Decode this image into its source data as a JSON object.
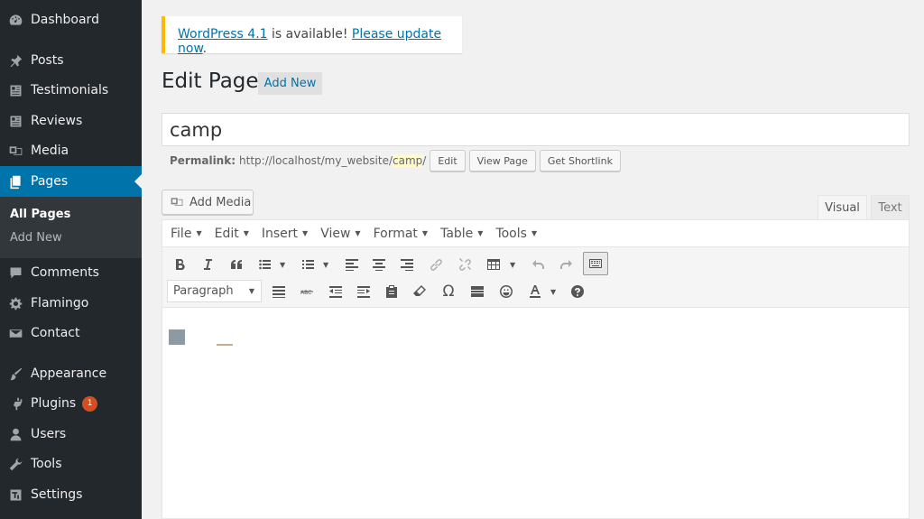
{
  "sidebar": {
    "items": [
      {
        "label": "Dashboard",
        "icon": "dashboard-icon"
      },
      {
        "label": "Posts",
        "icon": "pin-icon"
      },
      {
        "label": "Testimonials",
        "icon": "testimonial-icon"
      },
      {
        "label": "Reviews",
        "icon": "reviews-icon"
      },
      {
        "label": "Media",
        "icon": "media-icon"
      },
      {
        "label": "Pages",
        "icon": "pages-icon"
      },
      {
        "label": "Comments",
        "icon": "comments-icon"
      },
      {
        "label": "Flamingo",
        "icon": "gear-icon"
      },
      {
        "label": "Contact",
        "icon": "mail-icon"
      },
      {
        "label": "Appearance",
        "icon": "brush-icon"
      },
      {
        "label": "Plugins",
        "icon": "plugin-icon",
        "badge": "1"
      },
      {
        "label": "Users",
        "icon": "user-icon"
      },
      {
        "label": "Tools",
        "icon": "wrench-icon"
      },
      {
        "label": "Settings",
        "icon": "settings-icon"
      }
    ],
    "submenu": [
      "All Pages",
      "Add New"
    ]
  },
  "notice": {
    "link1": "WordPress 4.1",
    "middle": " is available! ",
    "link2": "Please update now",
    "end": "."
  },
  "header": {
    "title": "Edit Page",
    "add_new": "Add New"
  },
  "title_value": "camp",
  "permalink": {
    "label": "Permalink:",
    "url_prefix": "http://localhost/my_website/",
    "slug": "camp",
    "url_suffix": "/",
    "edit": "Edit",
    "view": "View Page",
    "shortlink": "Get Shortlink"
  },
  "editor": {
    "add_media": "Add Media",
    "tab_visual": "Visual",
    "tab_text": "Text",
    "menus": [
      "File",
      "Edit",
      "Insert",
      "View",
      "Format",
      "Table",
      "Tools"
    ],
    "format_select": "Paragraph"
  },
  "colors": {
    "accent": "#0073aa",
    "sidebar": "#23282d",
    "notice_border": "#ffba00",
    "badge": "#d54e21"
  }
}
